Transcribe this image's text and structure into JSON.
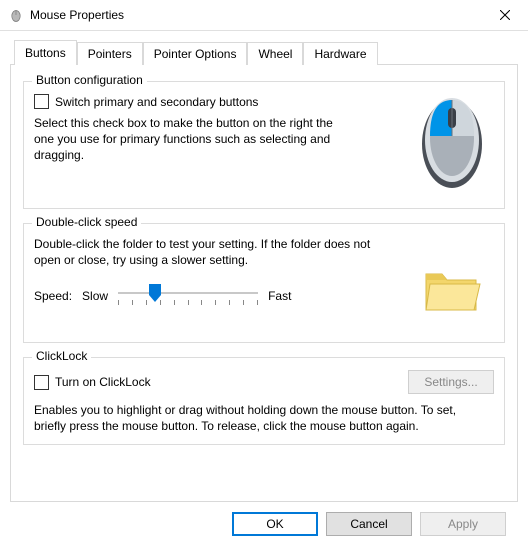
{
  "window": {
    "title": "Mouse Properties"
  },
  "tabs": {
    "buttons": "Buttons",
    "pointers": "Pointers",
    "pointer_options": "Pointer Options",
    "wheel": "Wheel",
    "hardware": "Hardware"
  },
  "group_button_config": {
    "legend": "Button configuration",
    "checkbox_label": "Switch primary and secondary buttons",
    "checkbox_checked": false,
    "description": "Select this check box to make the button on the right the one you use for primary functions such as selecting and dragging."
  },
  "group_doubleclick": {
    "legend": "Double-click speed",
    "description": "Double-click the folder to test your setting. If the folder does not open or close, try using a slower setting.",
    "speed_label": "Speed:",
    "slow_label": "Slow",
    "fast_label": "Fast",
    "slider_value": 3,
    "slider_min": 0,
    "slider_max": 10
  },
  "group_clicklock": {
    "legend": "ClickLock",
    "checkbox_label": "Turn on ClickLock",
    "checkbox_checked": false,
    "settings_button": "Settings...",
    "description": "Enables you to highlight or drag without holding down the mouse button. To set, briefly press the mouse button. To release, click the mouse button again."
  },
  "buttons": {
    "ok": "OK",
    "cancel": "Cancel",
    "apply": "Apply"
  }
}
